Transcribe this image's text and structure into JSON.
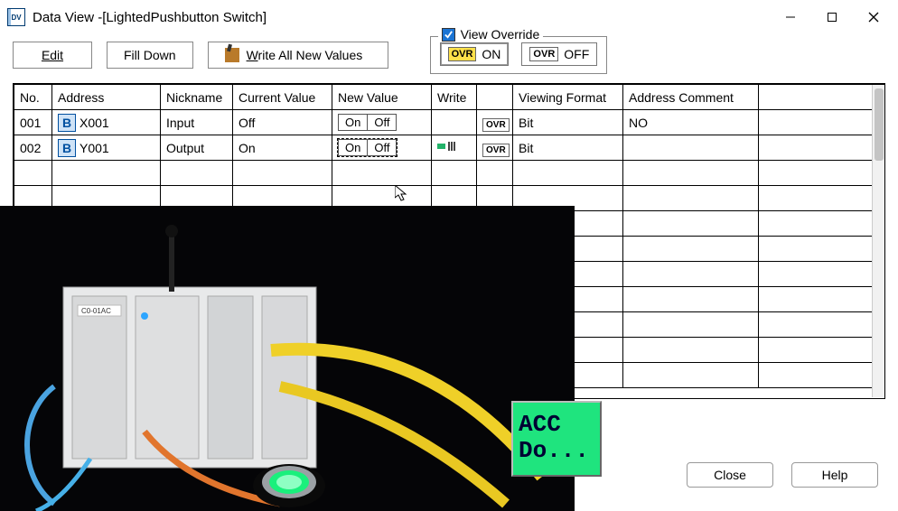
{
  "window": {
    "title": "Data View -[LightedPushbutton Switch]"
  },
  "toolbar": {
    "edit": "Edit",
    "fill_down": "Fill Down",
    "write_all": "Write All New Values"
  },
  "override": {
    "legend": "View Override",
    "on": {
      "tag": "OVR",
      "label": "ON"
    },
    "off": {
      "tag": "OVR",
      "label": "OFF"
    }
  },
  "table": {
    "headers": {
      "no": "No.",
      "address": "Address",
      "nickname": "Nickname",
      "current_value": "Current Value",
      "new_value": "New Value",
      "write": "Write",
      "ovr": "",
      "viewing_format": "Viewing Format",
      "address_comment": "Address Comment"
    },
    "rows": [
      {
        "no": "001",
        "address": "X001",
        "nickname": "Input",
        "current_value": "Off",
        "new_on": "On",
        "new_off": "Off",
        "dashed": false,
        "write_icon": false,
        "ovr": "OVR",
        "viewing_format": "Bit",
        "comment": "NO"
      },
      {
        "no": "002",
        "address": "Y001",
        "nickname": "Output",
        "current_value": "On",
        "new_on": "On",
        "new_off": "Off",
        "dashed": true,
        "write_icon": true,
        "ovr": "OVR",
        "viewing_format": "Bit",
        "comment": ""
      }
    ]
  },
  "accdo": {
    "line1": "ACC",
    "line2": "Do..."
  },
  "buttons": {
    "close": "Close",
    "help": "Help"
  }
}
